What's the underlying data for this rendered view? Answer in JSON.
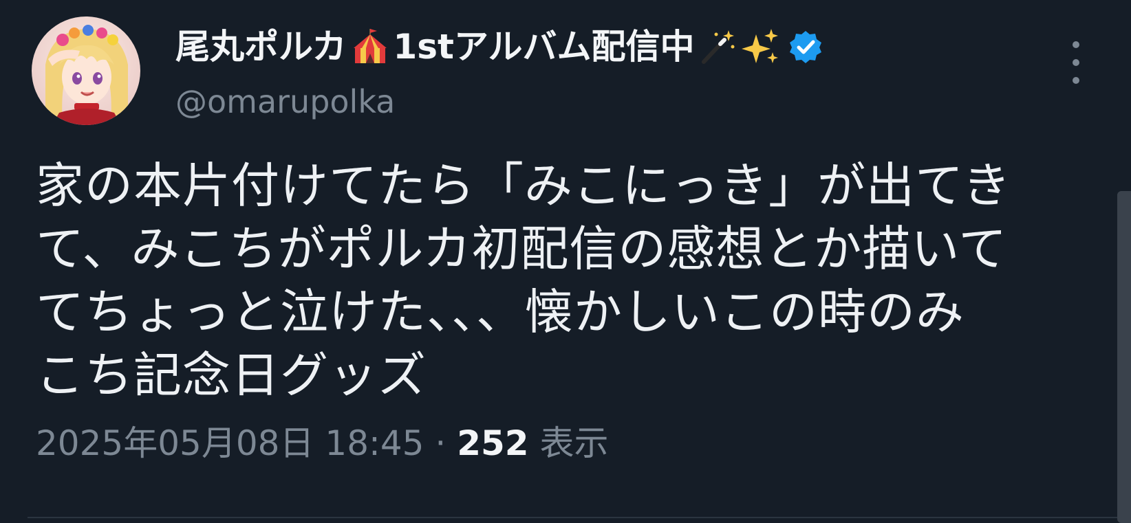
{
  "author": {
    "name": "尾丸ポルカ",
    "name_suffix": "1stアルバム配信中",
    "handle": "@omarupolka",
    "emoji": [
      "circus-tent",
      "magic-wand",
      "sparkles"
    ],
    "verified_icon": "verified-badge-icon"
  },
  "tweet": {
    "lines": [
      "家の本片付けてたら「みこにっき」が出てき",
      "て、みこちがポルカ初配信の感想とか描いて",
      "てちょっと泣けた、、、懐かしいこの時のみ",
      "こち記念日グッズ"
    ]
  },
  "meta": {
    "date": "2025年05月08日 18:45",
    "separator": "·",
    "views_count": "252",
    "views_label": "表示"
  },
  "colors": {
    "background": "#151d27",
    "text": "#eef1f4",
    "muted": "#7d8894",
    "verified": "#1d9bf0"
  }
}
